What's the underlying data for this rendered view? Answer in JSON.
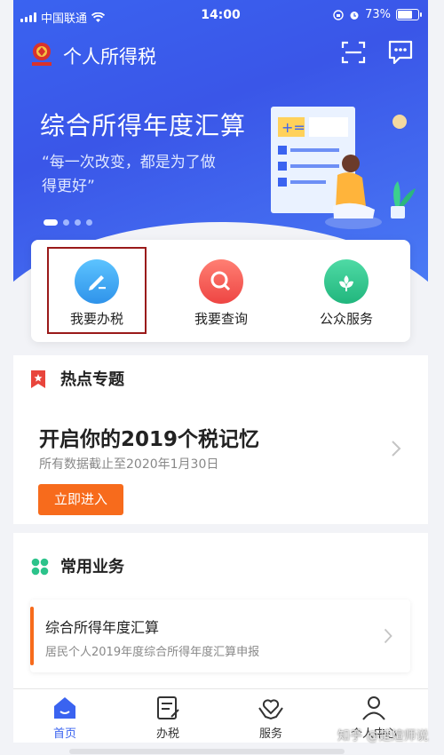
{
  "status_bar": {
    "carrier": "中国联通",
    "time": "14:00",
    "battery": "73%"
  },
  "app": {
    "title": "个人所得税"
  },
  "banner": {
    "title": "综合所得年度汇算",
    "subtitle": "“每一次改变，都是为了做得更好”",
    "page_count": 4,
    "active_page": 1
  },
  "quick_actions": [
    {
      "label": "我要办税",
      "icon": "pencil-icon",
      "color": "#33a7f0"
    },
    {
      "label": "我要查询",
      "icon": "magnifier-icon",
      "color": "#f0524d"
    },
    {
      "label": "公众服务",
      "icon": "flower-icon",
      "color": "#2cc38b"
    }
  ],
  "hot_topics": {
    "title": "热点专题",
    "headline": "开启你的2019个税记忆",
    "subtitle": "所有数据截止至2020年1月30日",
    "button": "立即进入"
  },
  "common_business": {
    "title": "常用业务",
    "items": [
      {
        "title": "综合所得年度汇算",
        "subtitle": "居民个人2019年度综合所得年度汇算申报"
      }
    ]
  },
  "tabs": [
    {
      "label": "首页",
      "icon": "home-icon",
      "active": true
    },
    {
      "label": "办税",
      "icon": "form-icon",
      "active": false
    },
    {
      "label": "服务",
      "icon": "heart-hands-icon",
      "active": false
    },
    {
      "label": "个人中心",
      "icon": "person-icon",
      "active": false
    }
  ],
  "watermark": "知乎 @楚煊师说",
  "colors": {
    "primary": "#3a63f0",
    "accent_orange": "#f76b1c",
    "highlight_border": "#9a1a1a"
  }
}
